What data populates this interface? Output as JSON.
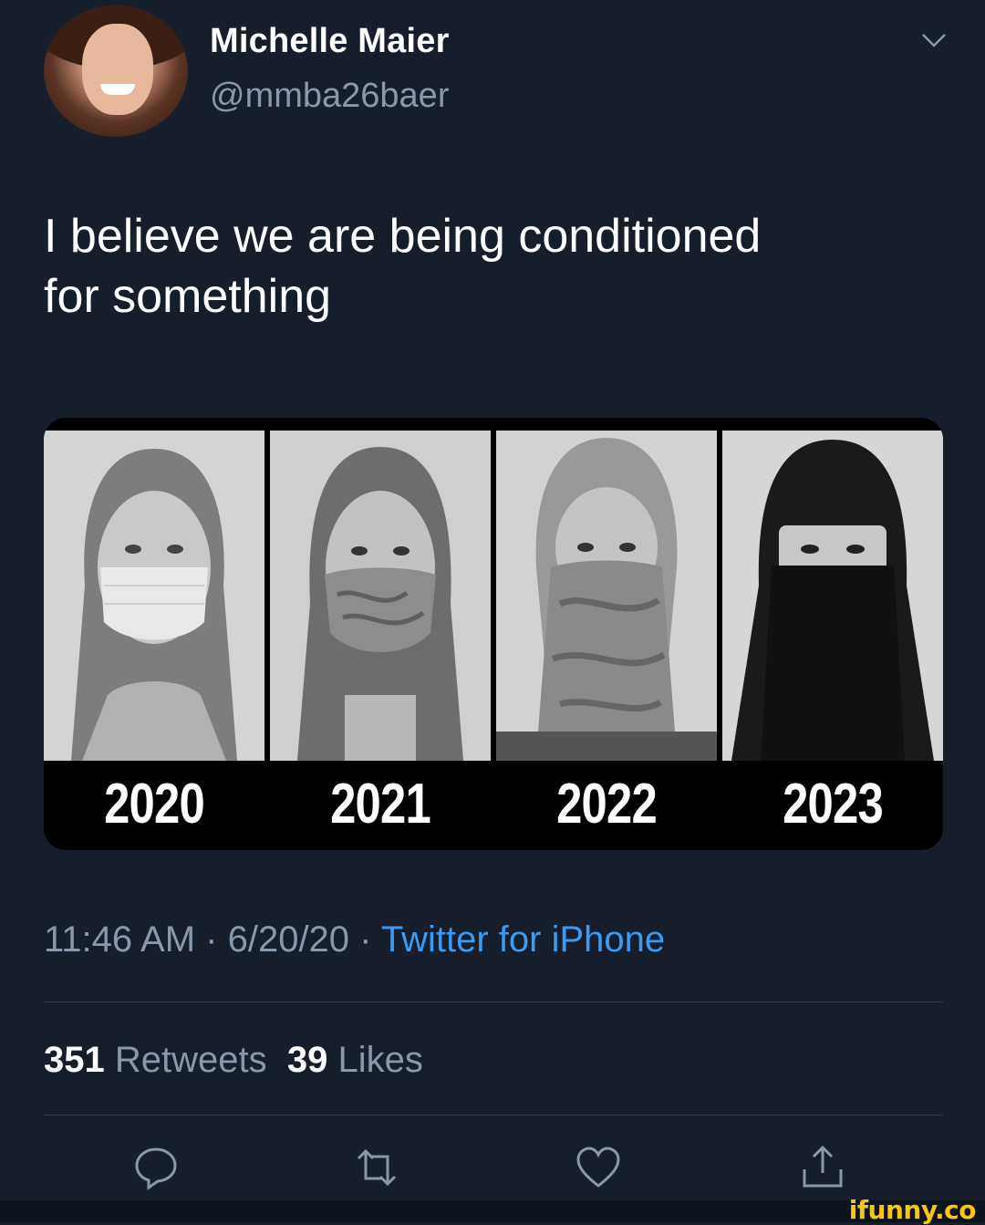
{
  "author": {
    "name": "Michelle Maier",
    "handle": "@mmba26baer"
  },
  "tweet": {
    "text": "I believe we are being conditioned\nfor something"
  },
  "media": {
    "panels": [
      {
        "year": "2020"
      },
      {
        "year": "2021"
      },
      {
        "year": "2022"
      },
      {
        "year": "2023"
      }
    ]
  },
  "meta": {
    "time": "11:46 AM",
    "separator": " · ",
    "date": "6/20/20",
    "source": "Twitter for iPhone"
  },
  "stats": {
    "retweets_count": "351",
    "retweets_label": "Retweets",
    "likes_count": "39",
    "likes_label": "Likes"
  },
  "icons": [
    "chevron-down-icon",
    "reply-icon",
    "retweet-icon",
    "like-icon",
    "share-icon"
  ],
  "colors": {
    "background": "#161d2b",
    "secondary_text": "#8a98ab",
    "link": "#3a9bf0",
    "watermark": "#f6c617"
  },
  "watermark": "ifunny.co"
}
